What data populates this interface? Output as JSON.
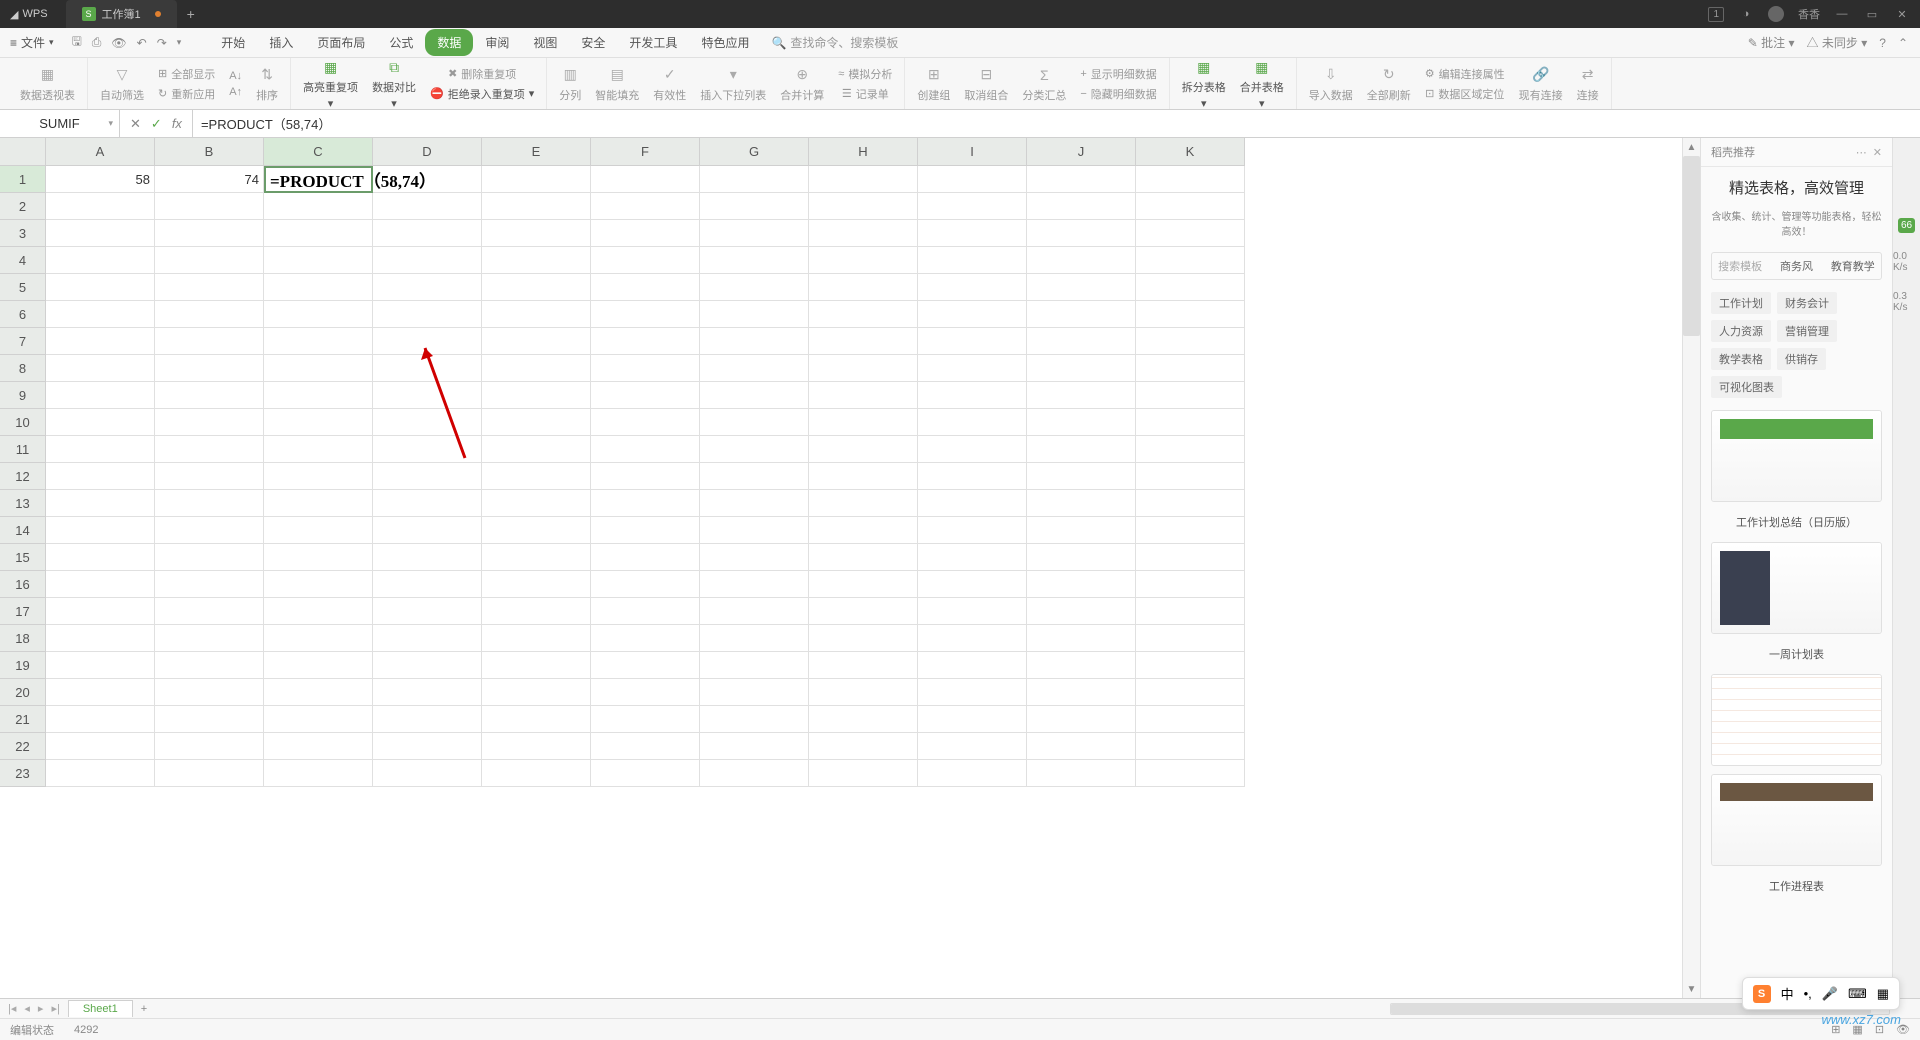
{
  "titlebar": {
    "app": "WPS",
    "tab_name": "工作簿1",
    "user": "香香",
    "notification_count": "1"
  },
  "menubar": {
    "file": "文件",
    "tabs": [
      "开始",
      "插入",
      "页面布局",
      "公式",
      "数据",
      "审阅",
      "视图",
      "安全",
      "开发工具",
      "特色应用"
    ],
    "active_tab_index": 4,
    "search_placeholder": "查找命令、搜索模板",
    "right_tools": {
      "comment": "批注",
      "sync": "未同步"
    }
  },
  "ribbon": {
    "buttons": {
      "pivot": "数据透视表",
      "auto_filter": "自动筛选",
      "show_all": "全部显示",
      "reapply": "重新应用",
      "sort": "排序",
      "highlight_dup": "高亮重复项",
      "data_compare": "数据对比",
      "reject_dup": "拒绝录入重复项",
      "delete_dup": "删除重复项",
      "split_col": "分列",
      "smart_fill": "智能填充",
      "validity": "有效性",
      "insert_dropdown": "插入下拉列表",
      "consolidate": "合并计算",
      "record_form": "记录单",
      "sim_analysis": "模拟分析",
      "create_group": "创建组",
      "ungroup": "取消组合",
      "subtotal": "分类汇总",
      "show_detail": "显示明细数据",
      "hide_detail": "隐藏明细数据",
      "split_table": "拆分表格",
      "merge_table": "合并表格",
      "import_data": "导入数据",
      "refresh_all": "全部刷新",
      "edit_conn": "编辑连接属性",
      "area_locate": "数据区域定位",
      "existing_conn": "现有连接",
      "link": "连接"
    }
  },
  "formulabar": {
    "namebox": "SUMIF",
    "formula": "=PRODUCT（58,74）"
  },
  "sheet": {
    "columns": [
      "A",
      "B",
      "C",
      "D",
      "E",
      "F",
      "G",
      "H",
      "I",
      "J",
      "K"
    ],
    "rows": [
      1,
      2,
      3,
      4,
      5,
      6,
      7,
      8,
      9,
      10,
      11,
      12,
      13,
      14,
      15,
      16,
      17,
      18,
      19,
      20,
      21,
      22,
      23
    ],
    "cells": {
      "A1": "58",
      "B1": "74",
      "C1": "=PRODUCT（58,74）"
    },
    "active": "C1"
  },
  "rpanel": {
    "header": "稻壳推荐",
    "title": "精选表格，高效管理",
    "subtitle": "含收集、统计、管理等功能表格，轻松高效！",
    "filter_tabs": [
      "搜索模板",
      "商务风",
      "教育教学"
    ],
    "categories": [
      "工作计划",
      "财务会计",
      "人力资源",
      "营销管理",
      "教学表格",
      "供销存",
      "可视化图表"
    ],
    "templates": [
      {
        "label": "工作计划总结（日历版）"
      },
      {
        "label": "一周计划表"
      },
      {
        "label": ""
      },
      {
        "label": "工作进程表"
      }
    ]
  },
  "sidestrip": {
    "badge": "66",
    "net1": "0.0 K/s",
    "net2": "0.3 K/s"
  },
  "sheettabs": {
    "active": "Sheet1"
  },
  "statusbar": {
    "mode": "编辑状态",
    "count": "4292"
  },
  "ime": {
    "lang": "中",
    "site": "www.xz7.com"
  }
}
